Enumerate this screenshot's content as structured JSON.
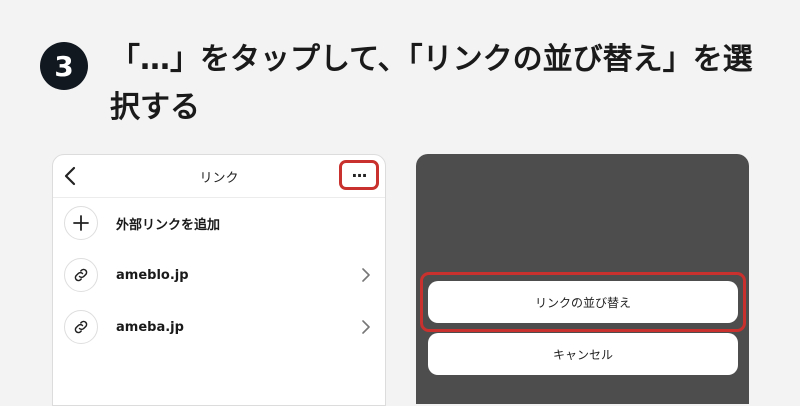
{
  "step": {
    "number": "3",
    "instruction": "「…」をタップして、「リンクの並び替え」を選択する"
  },
  "left_panel": {
    "title": "リンク",
    "more_button": "···",
    "items": [
      {
        "label": "外部リンクを追加",
        "icon": "plus-icon"
      },
      {
        "label": "ameblo.jp",
        "icon": "link-icon"
      },
      {
        "label": "ameba.jp",
        "icon": "link-icon"
      }
    ]
  },
  "right_panel": {
    "actions": [
      {
        "label": "リンクの並び替え"
      },
      {
        "label": "キャンセル"
      }
    ]
  },
  "colors": {
    "highlight": "#c8312d",
    "step_circle": "#111820",
    "overlay": "#4d4d4d",
    "background": "#f3f3f3"
  }
}
